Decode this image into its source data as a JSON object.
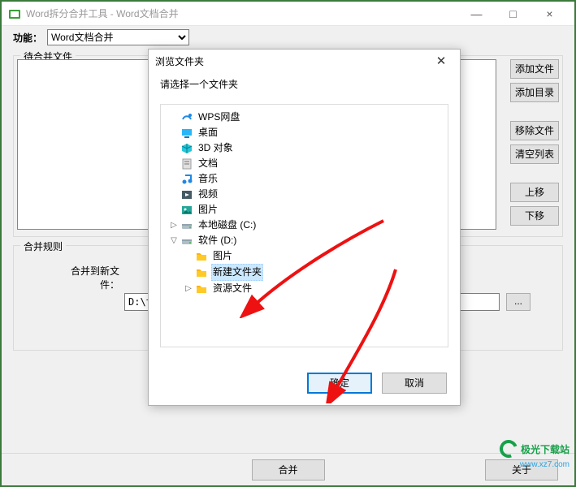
{
  "window": {
    "title": "Word拆分合并工具 - Word文档合并",
    "min": "—",
    "max": "□",
    "close": "×"
  },
  "toolbar": {
    "label": "功能：",
    "option": "Word文档合并"
  },
  "groups": {
    "files_legend": "待合并文件",
    "rules_legend": "合并规则"
  },
  "sidebuttons": {
    "add_file": "添加文件",
    "add_dir": "添加目录",
    "remove": "移除文件",
    "clear": "清空列表",
    "up": "上移",
    "down": "下移"
  },
  "rules": {
    "merge_to_label": "合并到新文件：",
    "path": "D:\\t",
    "browse": "...",
    "checkbox_label": ""
  },
  "bottom": {
    "merge": "合并",
    "about": "关于"
  },
  "watermark": {
    "text": "极光下载站",
    "url": "www.xz7.com"
  },
  "dialog": {
    "title": "浏览文件夹",
    "close": "✕",
    "prompt": "请选择一个文件夹",
    "ok": "确定",
    "cancel": "取消",
    "tree": [
      {
        "exp": "",
        "icon": "wps",
        "label": "WPS网盘"
      },
      {
        "exp": "",
        "icon": "desktop",
        "label": "桌面"
      },
      {
        "exp": "",
        "icon": "cube",
        "label": "3D 对象"
      },
      {
        "exp": "",
        "icon": "docs",
        "label": "文档"
      },
      {
        "exp": "",
        "icon": "music",
        "label": "音乐"
      },
      {
        "exp": "",
        "icon": "video",
        "label": "视频"
      },
      {
        "exp": "",
        "icon": "pics",
        "label": "图片"
      },
      {
        "exp": "▷",
        "icon": "drive",
        "label": "本地磁盘 (C:)"
      },
      {
        "exp": "▽",
        "icon": "drive",
        "label": "软件 (D:)",
        "children": [
          {
            "exp": "",
            "icon": "folder",
            "label": "图片"
          },
          {
            "exp": "",
            "icon": "folder",
            "label": "新建文件夹",
            "selected": true
          },
          {
            "exp": "▷",
            "icon": "folder",
            "label": "资源文件"
          }
        ]
      }
    ]
  }
}
